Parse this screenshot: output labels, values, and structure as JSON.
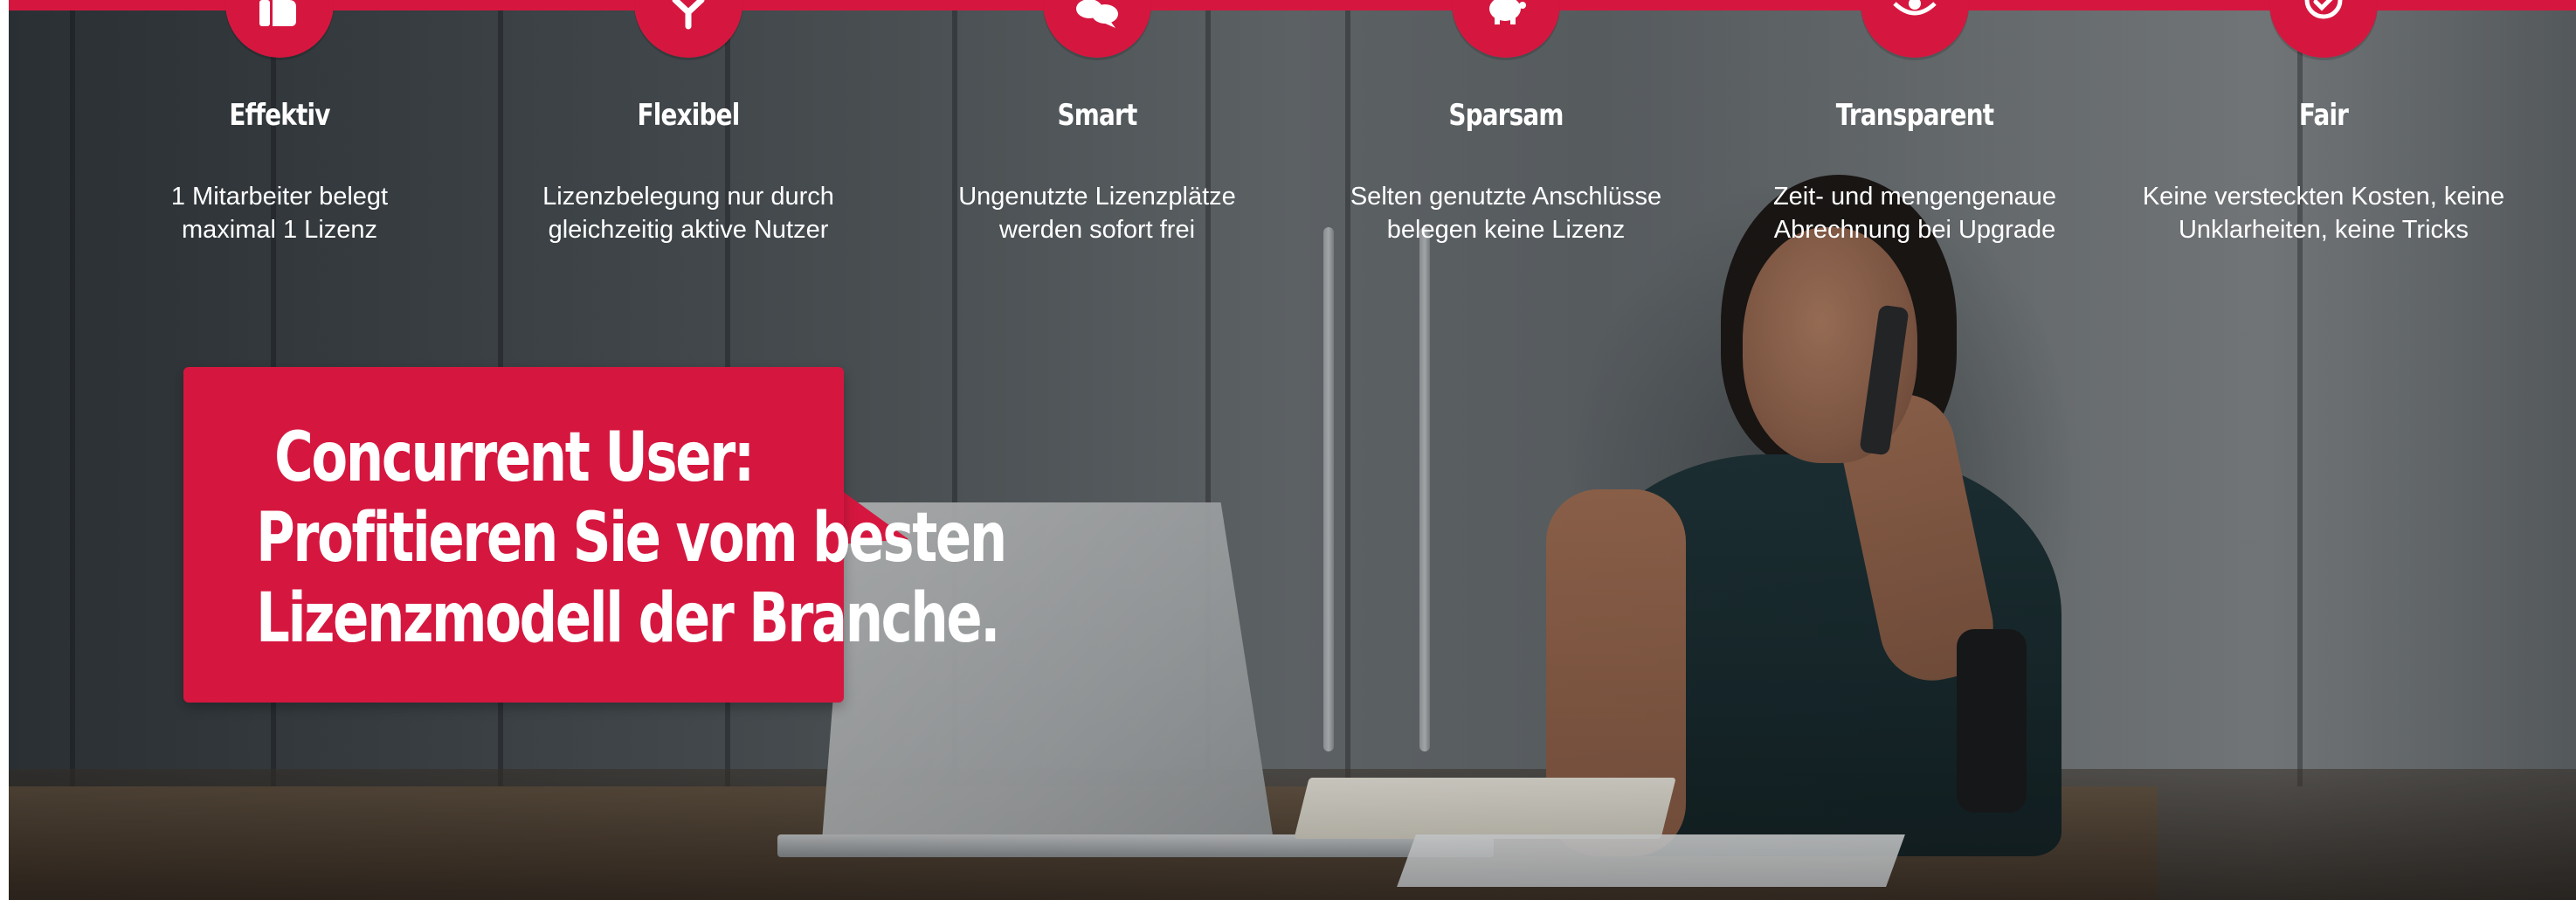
{
  "colors": {
    "accent": "#d5173f",
    "text": "#ffffff"
  },
  "features": [
    {
      "icon": "thumbs-up-icon",
      "title": "Effektiv",
      "desc_line1": "1 Mitarbeiter belegt",
      "desc_line2": "maximal 1 Lizenz"
    },
    {
      "icon": "branching-arrows-icon",
      "title": "Flexibel",
      "desc_line1": "Lizenzbelegung nur durch",
      "desc_line2": "gleichzeitig aktive Nutzer"
    },
    {
      "icon": "speech-bubbles-icon",
      "title": "Smart",
      "desc_line1": "Ungenutzte Lizenzplätze",
      "desc_line2": "werden sofort frei"
    },
    {
      "icon": "piggy-bank-icon",
      "title": "Sparsam",
      "desc_line1": "Selten genutzte Anschlüsse",
      "desc_line2": "belegen keine Lizenz"
    },
    {
      "icon": "eye-icon",
      "title": "Transparent",
      "desc_line1": "Zeit- und mengengenaue",
      "desc_line2": "Abrechnung bei Upgrade"
    },
    {
      "icon": "clock-icon",
      "title": "Fair",
      "desc_line1": "Keine versteckten Kosten, keine",
      "desc_line2": "Unklarheiten, keine Tricks"
    }
  ],
  "callout": {
    "line1": "Concurrent User:",
    "line2": "Profitieren Sie vom besten",
    "line3": "Lizenzmodell der Branche."
  }
}
